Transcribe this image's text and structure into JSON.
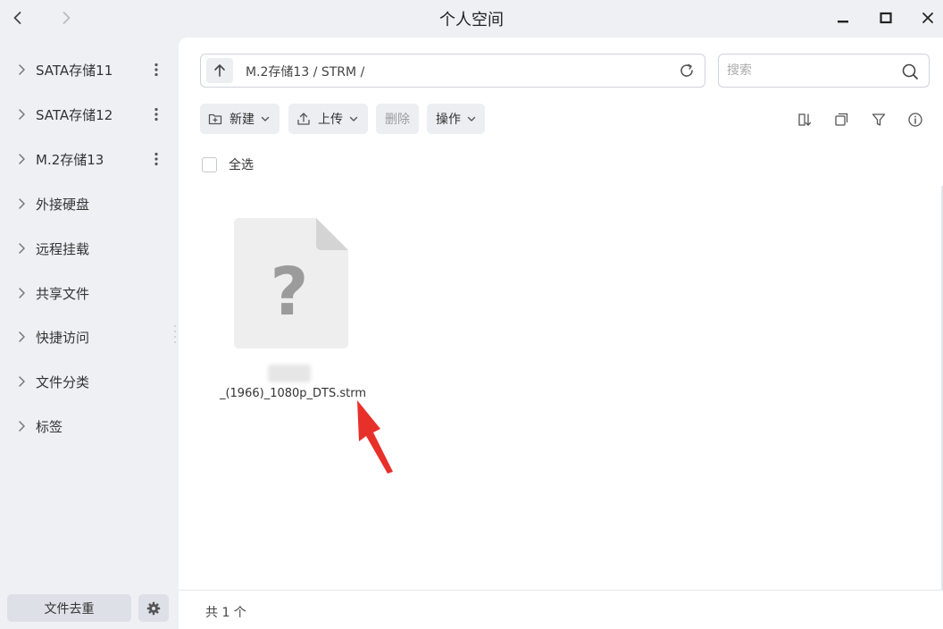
{
  "window": {
    "title": "个人空间"
  },
  "sidebar": {
    "items": [
      {
        "label": "SATA存储11",
        "has_more": true
      },
      {
        "label": "SATA存储12",
        "has_more": true
      },
      {
        "label": "M.2存储13",
        "has_more": true
      },
      {
        "label": "外接硬盘",
        "has_more": false
      },
      {
        "label": "远程挂载",
        "has_more": false
      },
      {
        "label": "共享文件",
        "has_more": false
      },
      {
        "label": "快捷访问",
        "has_more": false
      },
      {
        "label": "文件分类",
        "has_more": false
      },
      {
        "label": "标签",
        "has_more": false
      }
    ],
    "dedup_label": "文件去重"
  },
  "pathbar": {
    "path": "M.2存储13 / STRM /"
  },
  "search": {
    "placeholder": "搜索",
    "value": ""
  },
  "toolbar": {
    "new_label": "新建",
    "upload_label": "上传",
    "delete_label": "删除",
    "ops_label": "操作"
  },
  "selection": {
    "select_all_label": "全选"
  },
  "files": [
    {
      "name": "_(1966)_1080p_DTS.strm",
      "icon": "unknown-file-icon"
    }
  ],
  "status": {
    "count_text": "共 1 个"
  },
  "colors": {
    "annotation_arrow": "#e8302a",
    "main_bg": "#ffffff",
    "sidebar_bg": "#eef0f4"
  }
}
